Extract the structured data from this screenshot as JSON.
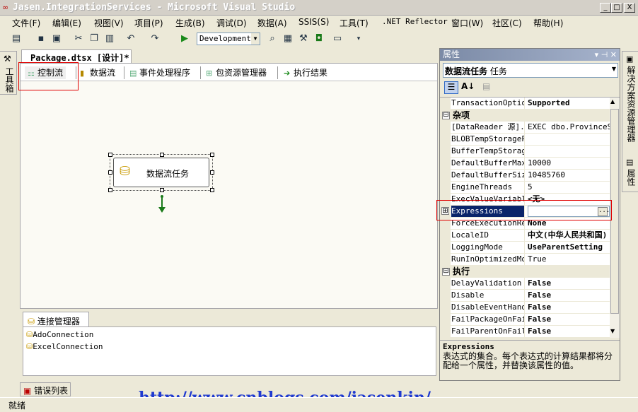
{
  "window": {
    "title": "Jasen.IntegrationServices - Microsoft Visual Studio",
    "min": "_",
    "max": "□",
    "close": "X"
  },
  "menu": [
    "文件(F)",
    "编辑(E)",
    "视图(V)",
    "项目(P)",
    "生成(B)",
    "调试(D)",
    "数据(A)",
    "SSIS(S)",
    "工具(T)",
    ".NET Reflector",
    "窗口(W)",
    "社区(C)",
    "帮助(H)"
  ],
  "toolbar": {
    "configuration": "Development"
  },
  "left_panel": {
    "toolbox_label": "工具箱"
  },
  "document_tab": {
    "label": "Package.dtsx [设计]*"
  },
  "designer_tabs": [
    "控制流",
    "数据流",
    "事件处理程序",
    "包资源管理器",
    "执行结果"
  ],
  "task": {
    "label": "数据流任务"
  },
  "connection_managers": {
    "tab_label": "连接管理器",
    "items": [
      "AdoConnection",
      "ExcelConnection"
    ]
  },
  "error_tab": {
    "label": "错误列表"
  },
  "watermark": "http://www.cnblogs.com/jasenkin/",
  "status": {
    "text": "就绪"
  },
  "properties": {
    "title": "属性",
    "pin": "▾ ⊣ ✕",
    "selected_object": {
      "name": "数据流任务",
      "type": "任务"
    },
    "rows": [
      {
        "name": "TransactionOption",
        "value": "Supported",
        "bold": true
      },
      {
        "category": "杂项",
        "toggle": "⊟"
      },
      {
        "name": "[DataReader 源].[",
        "value": "EXEC dbo.ProvinceSe"
      },
      {
        "name": "BLOBTempStoragePa",
        "value": ""
      },
      {
        "name": "BufferTempStorage",
        "value": ""
      },
      {
        "name": "DefaultBufferMaxR",
        "value": "10000"
      },
      {
        "name": "DefaultBufferSize",
        "value": "10485760"
      },
      {
        "name": "EngineThreads",
        "value": "5"
      },
      {
        "name": "ExecValueVariable",
        "value": "<无>",
        "bold": true
      },
      {
        "name": "Expressions",
        "value": "",
        "selected": true,
        "expand": "⊞"
      },
      {
        "name": "ForceExecutionRes",
        "value": "None",
        "bold": true
      },
      {
        "name": "LocaleID",
        "value": "中文(中华人民共和国)",
        "bold": true
      },
      {
        "name": "LoggingMode",
        "value": "UseParentSetting",
        "bold": true
      },
      {
        "name": "RunInOptimizedMod",
        "value": "True"
      },
      {
        "category": "执行",
        "toggle": "⊟"
      },
      {
        "name": "DelayValidation",
        "value": "False",
        "bold": true
      },
      {
        "name": "Disable",
        "value": "False",
        "bold": true
      },
      {
        "name": "DisableEventHandl",
        "value": "False",
        "bold": true
      },
      {
        "name": "FailPackageOnFail",
        "value": "False",
        "bold": true
      },
      {
        "name": "FailParentOnFailu",
        "value": "False",
        "bold": true
      }
    ],
    "description_title": "Expressions",
    "description_text": "表达式的集合。每个表达式的计算结果都将分配给一个属性，并替换该属性的值。"
  },
  "right_panel": {
    "tabs": [
      "解决方案资源管理器",
      "属性"
    ]
  }
}
